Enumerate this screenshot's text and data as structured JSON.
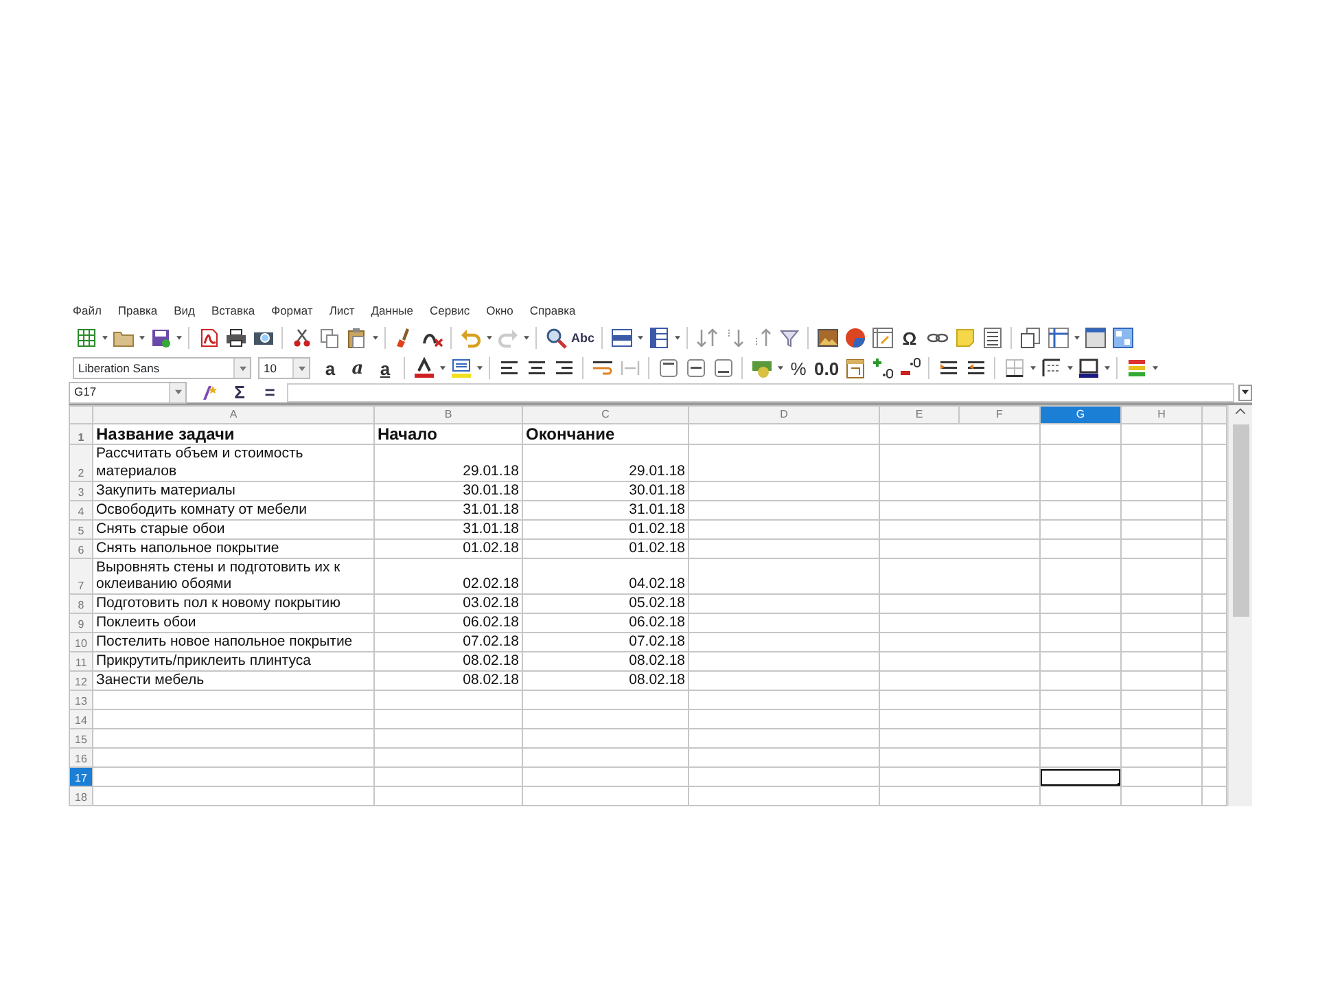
{
  "menu": [
    "Файл",
    "Правка",
    "Вид",
    "Вставка",
    "Формат",
    "Лист",
    "Данные",
    "Сервис",
    "Окно",
    "Справка"
  ],
  "toolbars": [
    [
      {
        "kind": "icon",
        "menu": true
      },
      {
        "kind": "icon",
        "menu": true
      },
      {
        "kind": "icon",
        "menu": true
      },
      {
        "kind": "separator"
      },
      {
        "kind": "icon",
        "menu": false
      },
      {
        "kind": "icon",
        "menu": false
      },
      {
        "kind": "icon",
        "menu": false
      },
      {
        "kind": "separator"
      },
      {
        "kind": "icon",
        "menu": false
      },
      {
        "kind": "icon",
        "menu": false
      },
      {
        "kind": "icon",
        "menu": true
      },
      {
        "kind": "separator"
      },
      {
        "kind": "icon",
        "menu": false
      },
      {
        "kind": "icon",
        "menu": false
      },
      {
        "kind": "separator"
      },
      {
        "kind": "icon",
        "menu": true
      },
      {
        "kind": "icon",
        "menu": true
      },
      {
        "kind": "separator"
      },
      {
        "kind": "icon",
        "menu": false
      },
      {
        "kind": "glyph",
        "label": "Abc"
      },
      {
        "kind": "separator"
      },
      {
        "kind": "icon",
        "menu": true
      },
      {
        "kind": "icon",
        "menu": true
      },
      {
        "kind": "separator"
      },
      {
        "kind": "icon",
        "menu": false
      },
      {
        "kind": "icon",
        "menu": false
      },
      {
        "kind": "icon",
        "menu": false
      },
      {
        "kind": "icon",
        "menu": false
      },
      {
        "kind": "separator"
      },
      {
        "kind": "icon",
        "menu": false
      },
      {
        "kind": "icon",
        "menu": false
      },
      {
        "kind": "icon",
        "menu": false
      },
      {
        "kind": "glyph",
        "label": "Ω"
      },
      {
        "kind": "icon",
        "menu": false
      },
      {
        "kind": "icon",
        "menu": false
      },
      {
        "kind": "icon",
        "menu": false
      },
      {
        "kind": "separator"
      },
      {
        "kind": "icon",
        "menu": false
      },
      {
        "kind": "icon",
        "menu": true
      },
      {
        "kind": "icon",
        "menu": false
      },
      {
        "kind": "icon",
        "menu": false
      }
    ],
    [
      {
        "kind": "combo",
        "value": "Liberation Sans"
      },
      {
        "kind": "combo",
        "value": "10"
      },
      {
        "kind": "glyph",
        "label": "a"
      },
      {
        "kind": "glyph",
        "label": "a"
      },
      {
        "kind": "glyph",
        "label": "a"
      },
      {
        "kind": "separator"
      },
      {
        "kind": "icon",
        "menu": true
      },
      {
        "kind": "icon",
        "menu": true
      },
      {
        "kind": "separator"
      },
      {
        "kind": "icon",
        "menu": false
      },
      {
        "kind": "icon",
        "menu": false
      },
      {
        "kind": "icon",
        "menu": false
      },
      {
        "kind": "separator"
      },
      {
        "kind": "icon",
        "menu": false
      },
      {
        "kind": "icon",
        "menu": false
      },
      {
        "kind": "separator"
      },
      {
        "kind": "icon",
        "menu": false
      },
      {
        "kind": "icon",
        "menu": false
      },
      {
        "kind": "icon",
        "menu": false
      },
      {
        "kind": "separator"
      },
      {
        "kind": "icon",
        "menu": true
      },
      {
        "kind": "glyph",
        "label": "%"
      },
      {
        "kind": "glyph",
        "label": "0.0"
      },
      {
        "kind": "icon",
        "menu": false
      },
      {
        "kind": "icon",
        "menu": false
      },
      {
        "kind": "icon",
        "menu": false
      },
      {
        "kind": "separator"
      },
      {
        "kind": "icon",
        "menu": false
      },
      {
        "kind": "icon",
        "menu": false
      },
      {
        "kind": "separator"
      },
      {
        "kind": "icon",
        "menu": true
      },
      {
        "kind": "icon",
        "menu": true
      },
      {
        "kind": "icon",
        "menu": true
      },
      {
        "kind": "separator"
      },
      {
        "kind": "icon",
        "menu": true
      }
    ]
  ],
  "formula_bar": {
    "name_box": "G17",
    "buttons": [
      "Σ",
      "="
    ]
  },
  "sheet": {
    "columns": [
      {
        "label": "A",
        "selected": false
      },
      {
        "label": "B",
        "selected": false
      },
      {
        "label": "C",
        "selected": false
      },
      {
        "label": "D",
        "selected": false
      },
      {
        "label": "E",
        "selected": false
      },
      {
        "label": "F",
        "selected": false
      },
      {
        "label": "G",
        "selected": true
      },
      {
        "label": "H",
        "selected": false
      }
    ],
    "rows": [
      {
        "number": "1",
        "kind": "heading",
        "selected": false,
        "cells": [
          "Название задачи",
          "Начало",
          "Окончание"
        ]
      },
      {
        "number": "2",
        "kind": "task",
        "selected": false,
        "cells": [
          "Рассчитать объем и стоимость материалов",
          "29.01.18",
          "29.01.18"
        ]
      },
      {
        "number": "3",
        "kind": "task",
        "selected": false,
        "cells": [
          "Закупить материалы",
          "30.01.18",
          "30.01.18"
        ]
      },
      {
        "number": "4",
        "kind": "task",
        "selected": false,
        "cells": [
          "Освободить комнату от мебели",
          "31.01.18",
          "31.01.18"
        ]
      },
      {
        "number": "5",
        "kind": "task",
        "selected": false,
        "cells": [
          "Снять старые обои",
          "31.01.18",
          "01.02.18"
        ]
      },
      {
        "number": "6",
        "kind": "task",
        "selected": false,
        "cells": [
          "Снять напольное покрытие",
          "01.02.18",
          "01.02.18"
        ]
      },
      {
        "number": "7",
        "kind": "task",
        "selected": false,
        "cells": [
          "Выровнять стены и подготовить их к оклеиванию обоями",
          "02.02.18",
          "04.02.18"
        ]
      },
      {
        "number": "8",
        "kind": "task",
        "selected": false,
        "cells": [
          "Подготовить пол к новому покрытию",
          "03.02.18",
          "05.02.18"
        ]
      },
      {
        "number": "9",
        "kind": "task",
        "selected": false,
        "cells": [
          "Поклеить обои",
          "06.02.18",
          "06.02.18"
        ]
      },
      {
        "number": "10",
        "kind": "task",
        "selected": false,
        "cells": [
          "Постелить новое напольное покрытие",
          "07.02.18",
          "07.02.18"
        ]
      },
      {
        "number": "11",
        "kind": "task",
        "selected": false,
        "cells": [
          "Прикрутить/приклеить плинтуса",
          "08.02.18",
          "08.02.18"
        ]
      },
      {
        "number": "12",
        "kind": "task",
        "selected": false,
        "cells": [
          "Занести мебель",
          "08.02.18",
          "08.02.18"
        ]
      },
      {
        "number": "13",
        "kind": "empty",
        "selected": false
      },
      {
        "number": "14",
        "kind": "empty",
        "selected": false
      },
      {
        "number": "15",
        "kind": "empty",
        "selected": false
      },
      {
        "number": "16",
        "kind": "empty",
        "selected": false
      },
      {
        "number": "17",
        "kind": "empty",
        "selected": true
      },
      {
        "number": "18",
        "kind": "empty",
        "selected": false
      }
    ]
  }
}
